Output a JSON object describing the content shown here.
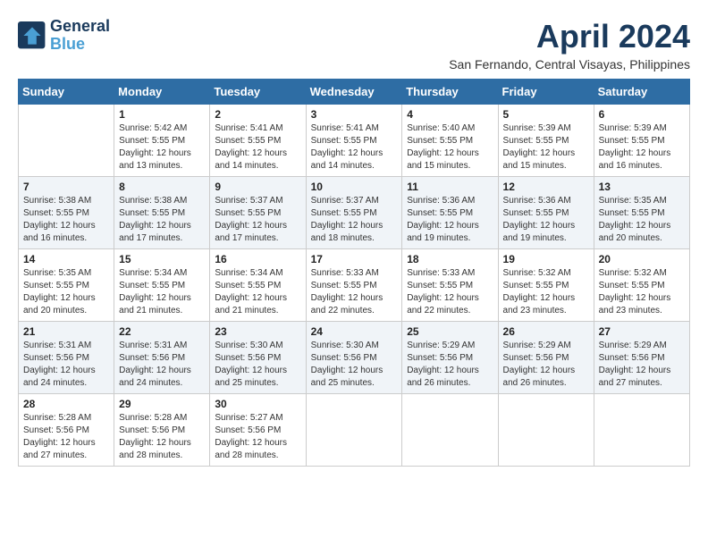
{
  "logo": {
    "text_general": "General",
    "text_blue": "Blue"
  },
  "title": "April 2024",
  "subtitle": "San Fernando, Central Visayas, Philippines",
  "weekdays": [
    "Sunday",
    "Monday",
    "Tuesday",
    "Wednesday",
    "Thursday",
    "Friday",
    "Saturday"
  ],
  "weeks": [
    [
      {
        "day": "",
        "sunrise": "",
        "sunset": "",
        "daylight": ""
      },
      {
        "day": "1",
        "sunrise": "Sunrise: 5:42 AM",
        "sunset": "Sunset: 5:55 PM",
        "daylight": "Daylight: 12 hours and 13 minutes."
      },
      {
        "day": "2",
        "sunrise": "Sunrise: 5:41 AM",
        "sunset": "Sunset: 5:55 PM",
        "daylight": "Daylight: 12 hours and 14 minutes."
      },
      {
        "day": "3",
        "sunrise": "Sunrise: 5:41 AM",
        "sunset": "Sunset: 5:55 PM",
        "daylight": "Daylight: 12 hours and 14 minutes."
      },
      {
        "day": "4",
        "sunrise": "Sunrise: 5:40 AM",
        "sunset": "Sunset: 5:55 PM",
        "daylight": "Daylight: 12 hours and 15 minutes."
      },
      {
        "day": "5",
        "sunrise": "Sunrise: 5:39 AM",
        "sunset": "Sunset: 5:55 PM",
        "daylight": "Daylight: 12 hours and 15 minutes."
      },
      {
        "day": "6",
        "sunrise": "Sunrise: 5:39 AM",
        "sunset": "Sunset: 5:55 PM",
        "daylight": "Daylight: 12 hours and 16 minutes."
      }
    ],
    [
      {
        "day": "7",
        "sunrise": "Sunrise: 5:38 AM",
        "sunset": "Sunset: 5:55 PM",
        "daylight": "Daylight: 12 hours and 16 minutes."
      },
      {
        "day": "8",
        "sunrise": "Sunrise: 5:38 AM",
        "sunset": "Sunset: 5:55 PM",
        "daylight": "Daylight: 12 hours and 17 minutes."
      },
      {
        "day": "9",
        "sunrise": "Sunrise: 5:37 AM",
        "sunset": "Sunset: 5:55 PM",
        "daylight": "Daylight: 12 hours and 17 minutes."
      },
      {
        "day": "10",
        "sunrise": "Sunrise: 5:37 AM",
        "sunset": "Sunset: 5:55 PM",
        "daylight": "Daylight: 12 hours and 18 minutes."
      },
      {
        "day": "11",
        "sunrise": "Sunrise: 5:36 AM",
        "sunset": "Sunset: 5:55 PM",
        "daylight": "Daylight: 12 hours and 19 minutes."
      },
      {
        "day": "12",
        "sunrise": "Sunrise: 5:36 AM",
        "sunset": "Sunset: 5:55 PM",
        "daylight": "Daylight: 12 hours and 19 minutes."
      },
      {
        "day": "13",
        "sunrise": "Sunrise: 5:35 AM",
        "sunset": "Sunset: 5:55 PM",
        "daylight": "Daylight: 12 hours and 20 minutes."
      }
    ],
    [
      {
        "day": "14",
        "sunrise": "Sunrise: 5:35 AM",
        "sunset": "Sunset: 5:55 PM",
        "daylight": "Daylight: 12 hours and 20 minutes."
      },
      {
        "day": "15",
        "sunrise": "Sunrise: 5:34 AM",
        "sunset": "Sunset: 5:55 PM",
        "daylight": "Daylight: 12 hours and 21 minutes."
      },
      {
        "day": "16",
        "sunrise": "Sunrise: 5:34 AM",
        "sunset": "Sunset: 5:55 PM",
        "daylight": "Daylight: 12 hours and 21 minutes."
      },
      {
        "day": "17",
        "sunrise": "Sunrise: 5:33 AM",
        "sunset": "Sunset: 5:55 PM",
        "daylight": "Daylight: 12 hours and 22 minutes."
      },
      {
        "day": "18",
        "sunrise": "Sunrise: 5:33 AM",
        "sunset": "Sunset: 5:55 PM",
        "daylight": "Daylight: 12 hours and 22 minutes."
      },
      {
        "day": "19",
        "sunrise": "Sunrise: 5:32 AM",
        "sunset": "Sunset: 5:55 PM",
        "daylight": "Daylight: 12 hours and 23 minutes."
      },
      {
        "day": "20",
        "sunrise": "Sunrise: 5:32 AM",
        "sunset": "Sunset: 5:55 PM",
        "daylight": "Daylight: 12 hours and 23 minutes."
      }
    ],
    [
      {
        "day": "21",
        "sunrise": "Sunrise: 5:31 AM",
        "sunset": "Sunset: 5:56 PM",
        "daylight": "Daylight: 12 hours and 24 minutes."
      },
      {
        "day": "22",
        "sunrise": "Sunrise: 5:31 AM",
        "sunset": "Sunset: 5:56 PM",
        "daylight": "Daylight: 12 hours and 24 minutes."
      },
      {
        "day": "23",
        "sunrise": "Sunrise: 5:30 AM",
        "sunset": "Sunset: 5:56 PM",
        "daylight": "Daylight: 12 hours and 25 minutes."
      },
      {
        "day": "24",
        "sunrise": "Sunrise: 5:30 AM",
        "sunset": "Sunset: 5:56 PM",
        "daylight": "Daylight: 12 hours and 25 minutes."
      },
      {
        "day": "25",
        "sunrise": "Sunrise: 5:29 AM",
        "sunset": "Sunset: 5:56 PM",
        "daylight": "Daylight: 12 hours and 26 minutes."
      },
      {
        "day": "26",
        "sunrise": "Sunrise: 5:29 AM",
        "sunset": "Sunset: 5:56 PM",
        "daylight": "Daylight: 12 hours and 26 minutes."
      },
      {
        "day": "27",
        "sunrise": "Sunrise: 5:29 AM",
        "sunset": "Sunset: 5:56 PM",
        "daylight": "Daylight: 12 hours and 27 minutes."
      }
    ],
    [
      {
        "day": "28",
        "sunrise": "Sunrise: 5:28 AM",
        "sunset": "Sunset: 5:56 PM",
        "daylight": "Daylight: 12 hours and 27 minutes."
      },
      {
        "day": "29",
        "sunrise": "Sunrise: 5:28 AM",
        "sunset": "Sunset: 5:56 PM",
        "daylight": "Daylight: 12 hours and 28 minutes."
      },
      {
        "day": "30",
        "sunrise": "Sunrise: 5:27 AM",
        "sunset": "Sunset: 5:56 PM",
        "daylight": "Daylight: 12 hours and 28 minutes."
      },
      {
        "day": "",
        "sunrise": "",
        "sunset": "",
        "daylight": ""
      },
      {
        "day": "",
        "sunrise": "",
        "sunset": "",
        "daylight": ""
      },
      {
        "day": "",
        "sunrise": "",
        "sunset": "",
        "daylight": ""
      },
      {
        "day": "",
        "sunrise": "",
        "sunset": "",
        "daylight": ""
      }
    ]
  ]
}
